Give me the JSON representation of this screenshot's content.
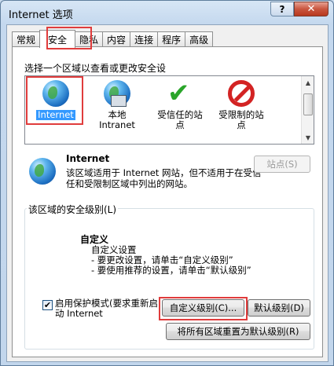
{
  "window": {
    "title": "Internet 选项",
    "help_glyph": "?",
    "close_glyph": "✕"
  },
  "tabs": [
    {
      "label": "常规"
    },
    {
      "label": "安全"
    },
    {
      "label": "隐私"
    },
    {
      "label": "内容"
    },
    {
      "label": "连接"
    },
    {
      "label": "程序"
    },
    {
      "label": "高级"
    }
  ],
  "zones": {
    "caption": "选择一个区域以查看或更改安全设",
    "items": [
      {
        "label": "Internet",
        "icon": "globe-icon"
      },
      {
        "label": "本地\nIntranet",
        "icon": "intranet-icon"
      },
      {
        "label": "受信任的站\n点",
        "icon": "trusted-sites-icon"
      },
      {
        "label": "受限制的站\n点",
        "icon": "restricted-sites-icon"
      }
    ],
    "selected": "Internet"
  },
  "description": {
    "title": "Internet",
    "text": "该区域适用于 Internet 网站，但不适用于在受信任和受限制区域中列出的网站。",
    "sites_button": "站点(S)"
  },
  "security_level": {
    "group_label": "该区域的安全级别(L)",
    "level_title": "自定义",
    "lines": [
      "自定义设置",
      "- 要更改设置，请单击“自定义级别”",
      "- 要使用推荐的设置，请单击“默认级别”"
    ],
    "protected_mode_label": "启用保护模式(要求重新启动 Internet",
    "protected_mode_checked": true,
    "custom_level_button": "自定义级别(C)...",
    "default_level_button": "默认级别(D)",
    "reset_all_button": "将所有区域重置为默认级别(R)"
  },
  "accent_colors": {
    "highlight_red": "#e03c3c",
    "selection_blue": "#3399ff"
  }
}
